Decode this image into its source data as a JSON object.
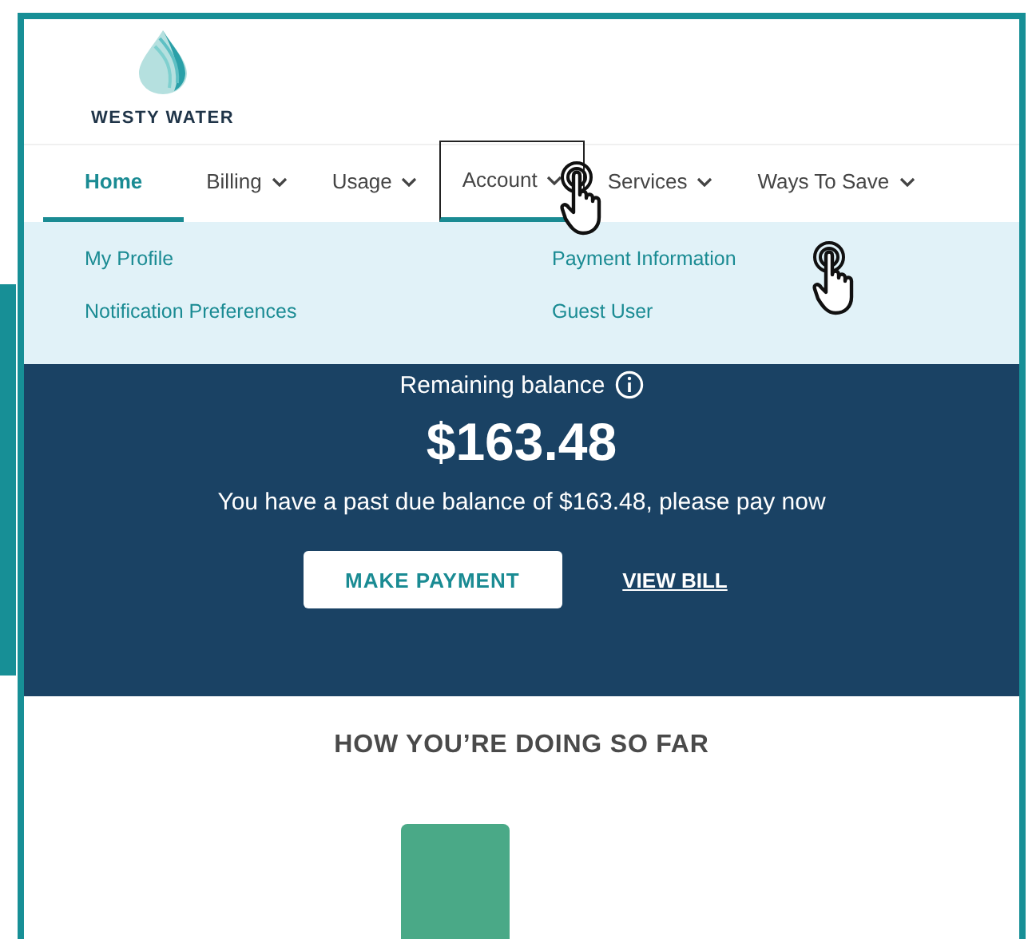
{
  "brand": {
    "name": "WESTY WATER"
  },
  "nav": [
    {
      "label": "Home",
      "selected": true,
      "has_menu": false,
      "expanded": false
    },
    {
      "label": "Billing",
      "selected": false,
      "has_menu": true,
      "expanded": false
    },
    {
      "label": "Usage",
      "selected": false,
      "has_menu": true,
      "expanded": false
    },
    {
      "label": "Account",
      "selected": false,
      "has_menu": true,
      "expanded": true
    },
    {
      "label": "Services",
      "selected": false,
      "has_menu": true,
      "expanded": false
    },
    {
      "label": "Ways To Save",
      "selected": false,
      "has_menu": true,
      "expanded": false
    }
  ],
  "dropdown": {
    "columns": [
      [
        "My Profile",
        "Notification Preferences"
      ],
      [
        "Payment Information",
        "Guest User"
      ]
    ]
  },
  "balance": {
    "label": "Remaining balance",
    "amount": "$163.48",
    "message": "You have a past due balance of $163.48, please pay now",
    "primary_button": "MAKE PAYMENT",
    "link": "VIEW BILL"
  },
  "progress": {
    "heading": "HOW YOU’RE DOING SO FAR"
  }
}
